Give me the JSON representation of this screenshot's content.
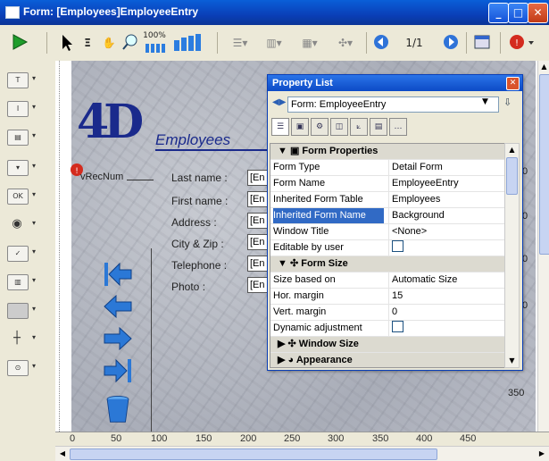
{
  "window": {
    "title": "Form: [Employees]EmployeeEntry",
    "minimize": "_",
    "maximize": "□",
    "close": "✕"
  },
  "toolbar": {
    "zoom_label": "100%",
    "page_indicator": "1/1"
  },
  "form": {
    "logo": "4D",
    "heading": "Employees",
    "rec_num": "vRecNum",
    "labels": [
      "Last name :",
      "First name :",
      "Address :",
      "City & Zip :",
      "Telephone :",
      "Photo :"
    ],
    "field_text": "[En"
  },
  "ruler": {
    "ticks": [
      "0",
      "50",
      "100",
      "150",
      "200",
      "250",
      "300",
      "350",
      "400",
      "450"
    ],
    "side_value": "350",
    "side_digits": [
      "0",
      "0",
      "0",
      "0"
    ]
  },
  "property_list": {
    "title": "Property List",
    "selector": "Form: EmployeeEntry",
    "sections": [
      {
        "label": "Form Properties"
      },
      {
        "label": "Form Size"
      },
      {
        "label": "Window Size"
      },
      {
        "label": "Appearance"
      }
    ],
    "rows": [
      {
        "key": "Form Type",
        "value": "Detail Form"
      },
      {
        "key": "Form Name",
        "value": "EmployeeEntry"
      },
      {
        "key": "Inherited Form Table",
        "value": "Employees"
      },
      {
        "key": "Inherited Form Name",
        "value": "Background"
      },
      {
        "key": "Window Title",
        "value": "<None>"
      },
      {
        "key": "Editable by user",
        "value": ""
      },
      {
        "key": "Size based on",
        "value": "Automatic Size"
      },
      {
        "key": "Hor. margin",
        "value": "15"
      },
      {
        "key": "Vert. margin",
        "value": "0"
      },
      {
        "key": "Dynamic adjustment",
        "value": ""
      }
    ]
  },
  "colors": {
    "titlebar": "#0a3fb8",
    "selection": "#316ac5"
  }
}
